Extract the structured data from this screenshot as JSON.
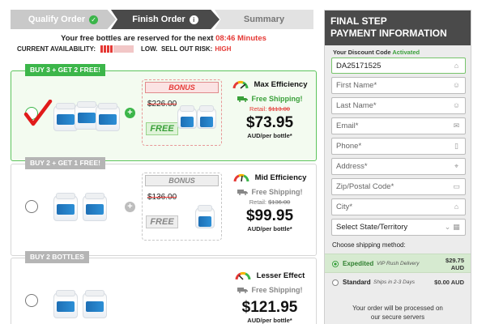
{
  "steps": [
    {
      "label": "Qualify Order",
      "state": "done",
      "icon": "check-icon"
    },
    {
      "label": "Finish Order",
      "state": "current",
      "icon": "info-icon"
    },
    {
      "label": "Summary",
      "state": "pending"
    }
  ],
  "reserve": {
    "text": "Your free bottles are reserved for the next",
    "timer": "08:46 Minutes"
  },
  "availability": {
    "label": "CURRENT AVAILABILITY:",
    "level_fraction": 0.15,
    "level": "LOW.",
    "risk_label": "SELL OUT RISK:",
    "risk": "HIGH"
  },
  "offers": [
    {
      "ribbon": "BUY 3 + GET 2 FREE!",
      "selected": true,
      "bonus_label": "BONUS",
      "bonus_old_price": "$226.00",
      "bonus_free": "FREE",
      "efficiency": "Max Efficiency",
      "shipping": "Free Shipping!",
      "retail_label": "Retail:",
      "retail_price": "$113.00",
      "price": "$73.95",
      "per": "AUD/per bottle*"
    },
    {
      "ribbon": "BUY 2 + GET 1 FREE!",
      "selected": false,
      "bonus_label": "BONUS",
      "bonus_old_price": "$136.00",
      "bonus_free": "FREE",
      "efficiency": "Mid Efficiency",
      "shipping": "Free Shipping!",
      "retail_label": "Retail:",
      "retail_price": "$136.00",
      "price": "$99.95",
      "per": "AUD/per bottle*"
    },
    {
      "ribbon": "BUY 2 BOTTLES",
      "selected": false,
      "efficiency": "Lesser Effect",
      "shipping": "Free Shipping!",
      "price": "$121.95",
      "per": "AUD/per bottle*"
    }
  ],
  "payment": {
    "title_line1": "FINAL STEP",
    "title_line2": "PAYMENT INFORMATION",
    "discount_label": "Your Discount Code",
    "discount_status": "Activated",
    "discount_code": "DA25171525",
    "placeholders": {
      "first_name": "First Name*",
      "last_name": "Last Name*",
      "email": "Email*",
      "phone": "Phone*",
      "address": "Address*",
      "zip": "Zip/Postal Code*",
      "city": "City*"
    },
    "state_select": "Select State/Territory",
    "shipping_label": "Choose shipping method:",
    "shipping_options": [
      {
        "name": "Expedited",
        "desc": "VIP Rush Delivery",
        "cost_line1": "$29.75",
        "cost_line2": "AUD",
        "selected": true
      },
      {
        "name": "Standard",
        "desc": "Ships in 2-3 Days",
        "cost_line1": "$0.00 AUD",
        "cost_line2": "",
        "selected": false
      }
    ],
    "processed_line1": "Your order will be processed on",
    "processed_line2": "our secure servers"
  },
  "colors": {
    "accent_green": "#3cb64a",
    "alert_red": "#e53935",
    "header_dark": "#4a4a4a"
  }
}
